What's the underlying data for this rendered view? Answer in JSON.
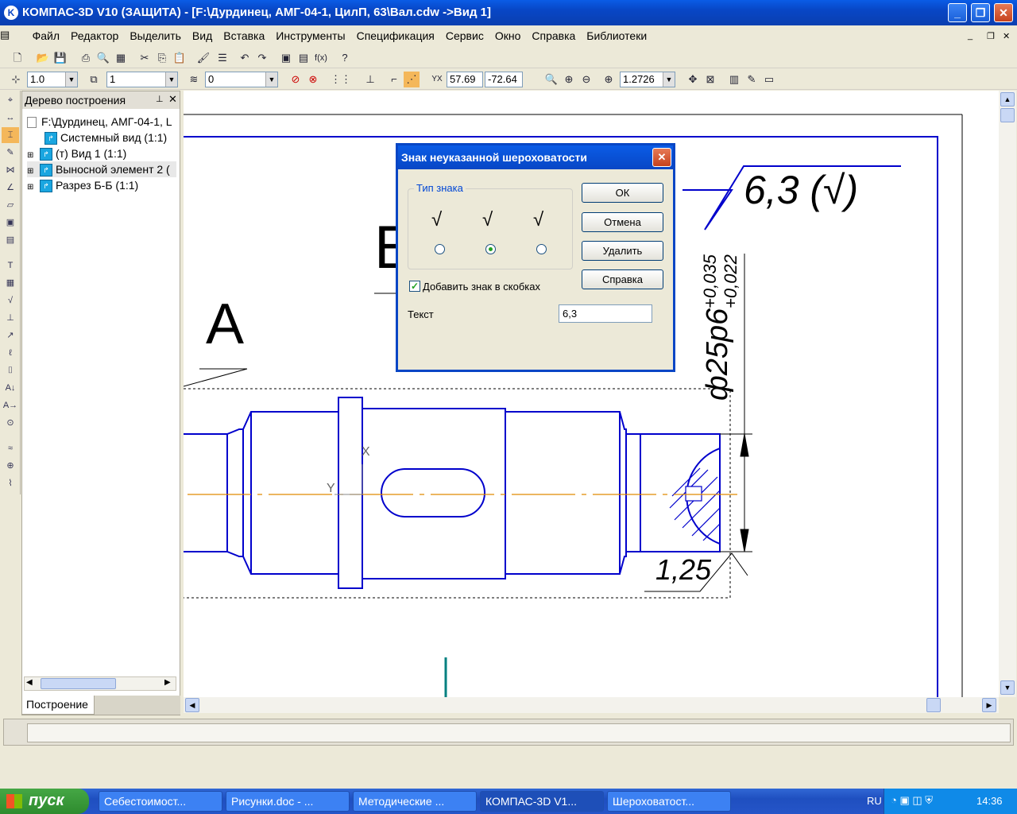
{
  "app": {
    "title": "КОМПАС-3D V10 (ЗАЩИТА) - [F:\\Дурдинец, АМГ-04-1, ЦилП, 63\\Вал.cdw ->Вид 1]",
    "icon": "kompas-logo-icon"
  },
  "menu": [
    "Файл",
    "Редактор",
    "Выделить",
    "Вид",
    "Вставка",
    "Инструменты",
    "Спецификация",
    "Сервис",
    "Окно",
    "Справка",
    "Библиотеки"
  ],
  "toolbar2": {
    "step_value": "1.0",
    "layer_value": "1",
    "style_value": "0",
    "x_coord": "57.69",
    "y_coord": "-72.64",
    "zoom_value": "1.2726"
  },
  "tree": {
    "header": "Дерево построения",
    "root": "F:\\Дурдинец, АМГ-04-1, L",
    "items": [
      {
        "label": "Системный вид (1:1)"
      },
      {
        "label": "(т) Вид 1 (1:1)"
      },
      {
        "label": "Выносной элемент 2 ("
      },
      {
        "label": "Разрез Б-Б (1:1)"
      }
    ],
    "tab": "Построение"
  },
  "drawing": {
    "section_letter_b": "Б",
    "view_letter": "A",
    "roughness_value": "6,3",
    "roughness_bracket_text": "6,3 (√)",
    "dimension_label": "ф25р6",
    "tolerance_upper": "+0,035",
    "tolerance_lower": "+0,022",
    "chamfer_label": "1,25",
    "axis_x": "X",
    "axis_y": "Y"
  },
  "dialog": {
    "title": "Знак неуказанной шероховатости",
    "group_label": "Тип знака",
    "sign_types": [
      "√",
      "√",
      "√"
    ],
    "selected_index": 1,
    "checkbox_label": "Добавить знак в скобках",
    "checkbox_checked": true,
    "text_label": "Текст",
    "text_value": "6,3",
    "buttons": {
      "ok": "ОК",
      "cancel": "Отмена",
      "delete": "Удалить",
      "help": "Справка"
    }
  },
  "taskbar": {
    "start": "пуск",
    "tasks": [
      "Себестоимост...",
      "Рисунки.doc - ...",
      "Методические ...",
      "КОМПАС-3D V1...",
      "Шероховатост..."
    ],
    "active_index": 3,
    "lang": "RU",
    "time": "14:36"
  },
  "colors": {
    "drawing_blue": "#0000cc",
    "axis_orange": "#e08a00",
    "titlebar": "#0846c5"
  }
}
